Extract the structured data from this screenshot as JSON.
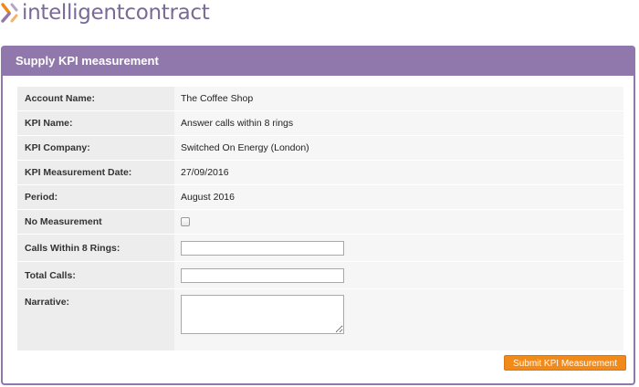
{
  "logo": {
    "text": "intelligentcontract"
  },
  "panel": {
    "title": "Supply KPI measurement"
  },
  "form": {
    "account_name": {
      "label": "Account Name:",
      "value": "The Coffee Shop"
    },
    "kpi_name": {
      "label": "KPI Name:",
      "value": "Answer calls within 8 rings"
    },
    "kpi_company": {
      "label": "KPI Company:",
      "value": "Switched On Energy (London)"
    },
    "measurement_date": {
      "label": "KPI Measurement Date:",
      "value": "27/09/2016"
    },
    "period": {
      "label": "Period:",
      "value": "August 2016"
    },
    "no_measurement": {
      "label": "No Measurement",
      "checked": false
    },
    "calls_within": {
      "label": "Calls Within 8 Rings:",
      "value": ""
    },
    "total_calls": {
      "label": "Total Calls:",
      "value": ""
    },
    "narrative": {
      "label": "Narrative:",
      "value": ""
    }
  },
  "buttons": {
    "submit_label": "Submit KPI Measurement"
  },
  "colors": {
    "accent": "#9178ac",
    "button": "#f28a1a",
    "logo_text": "#7a6a98"
  }
}
